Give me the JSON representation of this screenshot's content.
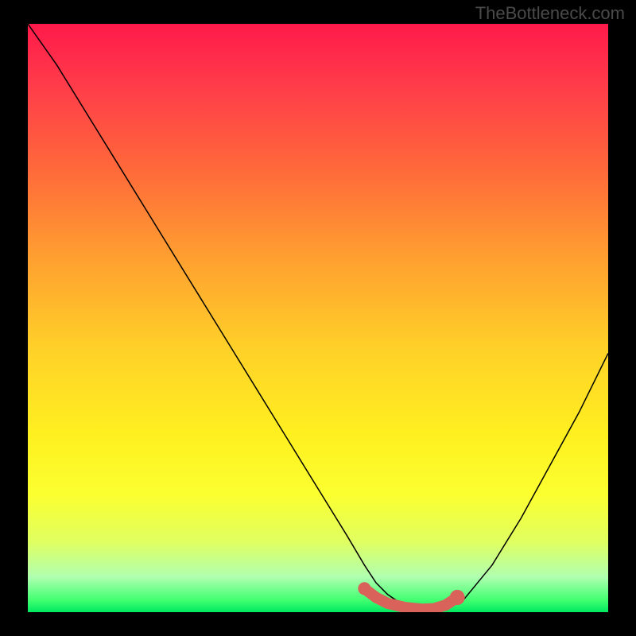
{
  "watermark": "TheBottleneck.com",
  "chart_data": {
    "type": "line",
    "title": "",
    "xlabel": "",
    "ylabel": "",
    "xlim": [
      0,
      100
    ],
    "ylim": [
      0,
      100
    ],
    "grid": false,
    "series": [
      {
        "name": "curve",
        "color": "#000000",
        "x": [
          0,
          5,
          10,
          15,
          20,
          25,
          30,
          35,
          40,
          45,
          50,
          55,
          58,
          60,
          62,
          65,
          68,
          70,
          72,
          75,
          80,
          85,
          90,
          95,
          100
        ],
        "y": [
          100,
          93,
          85,
          77,
          69,
          61,
          53,
          45,
          37,
          29,
          21,
          13,
          8,
          5,
          3,
          1,
          0,
          0,
          0.5,
          2,
          8,
          16,
          25,
          34,
          44
        ]
      },
      {
        "name": "highlight",
        "color": "#d9635a",
        "x": [
          58,
          60,
          62,
          65,
          68,
          70,
          72,
          74
        ],
        "y": [
          4,
          2.5,
          1.5,
          0.8,
          0.5,
          0.6,
          1.2,
          2.5
        ]
      }
    ]
  }
}
